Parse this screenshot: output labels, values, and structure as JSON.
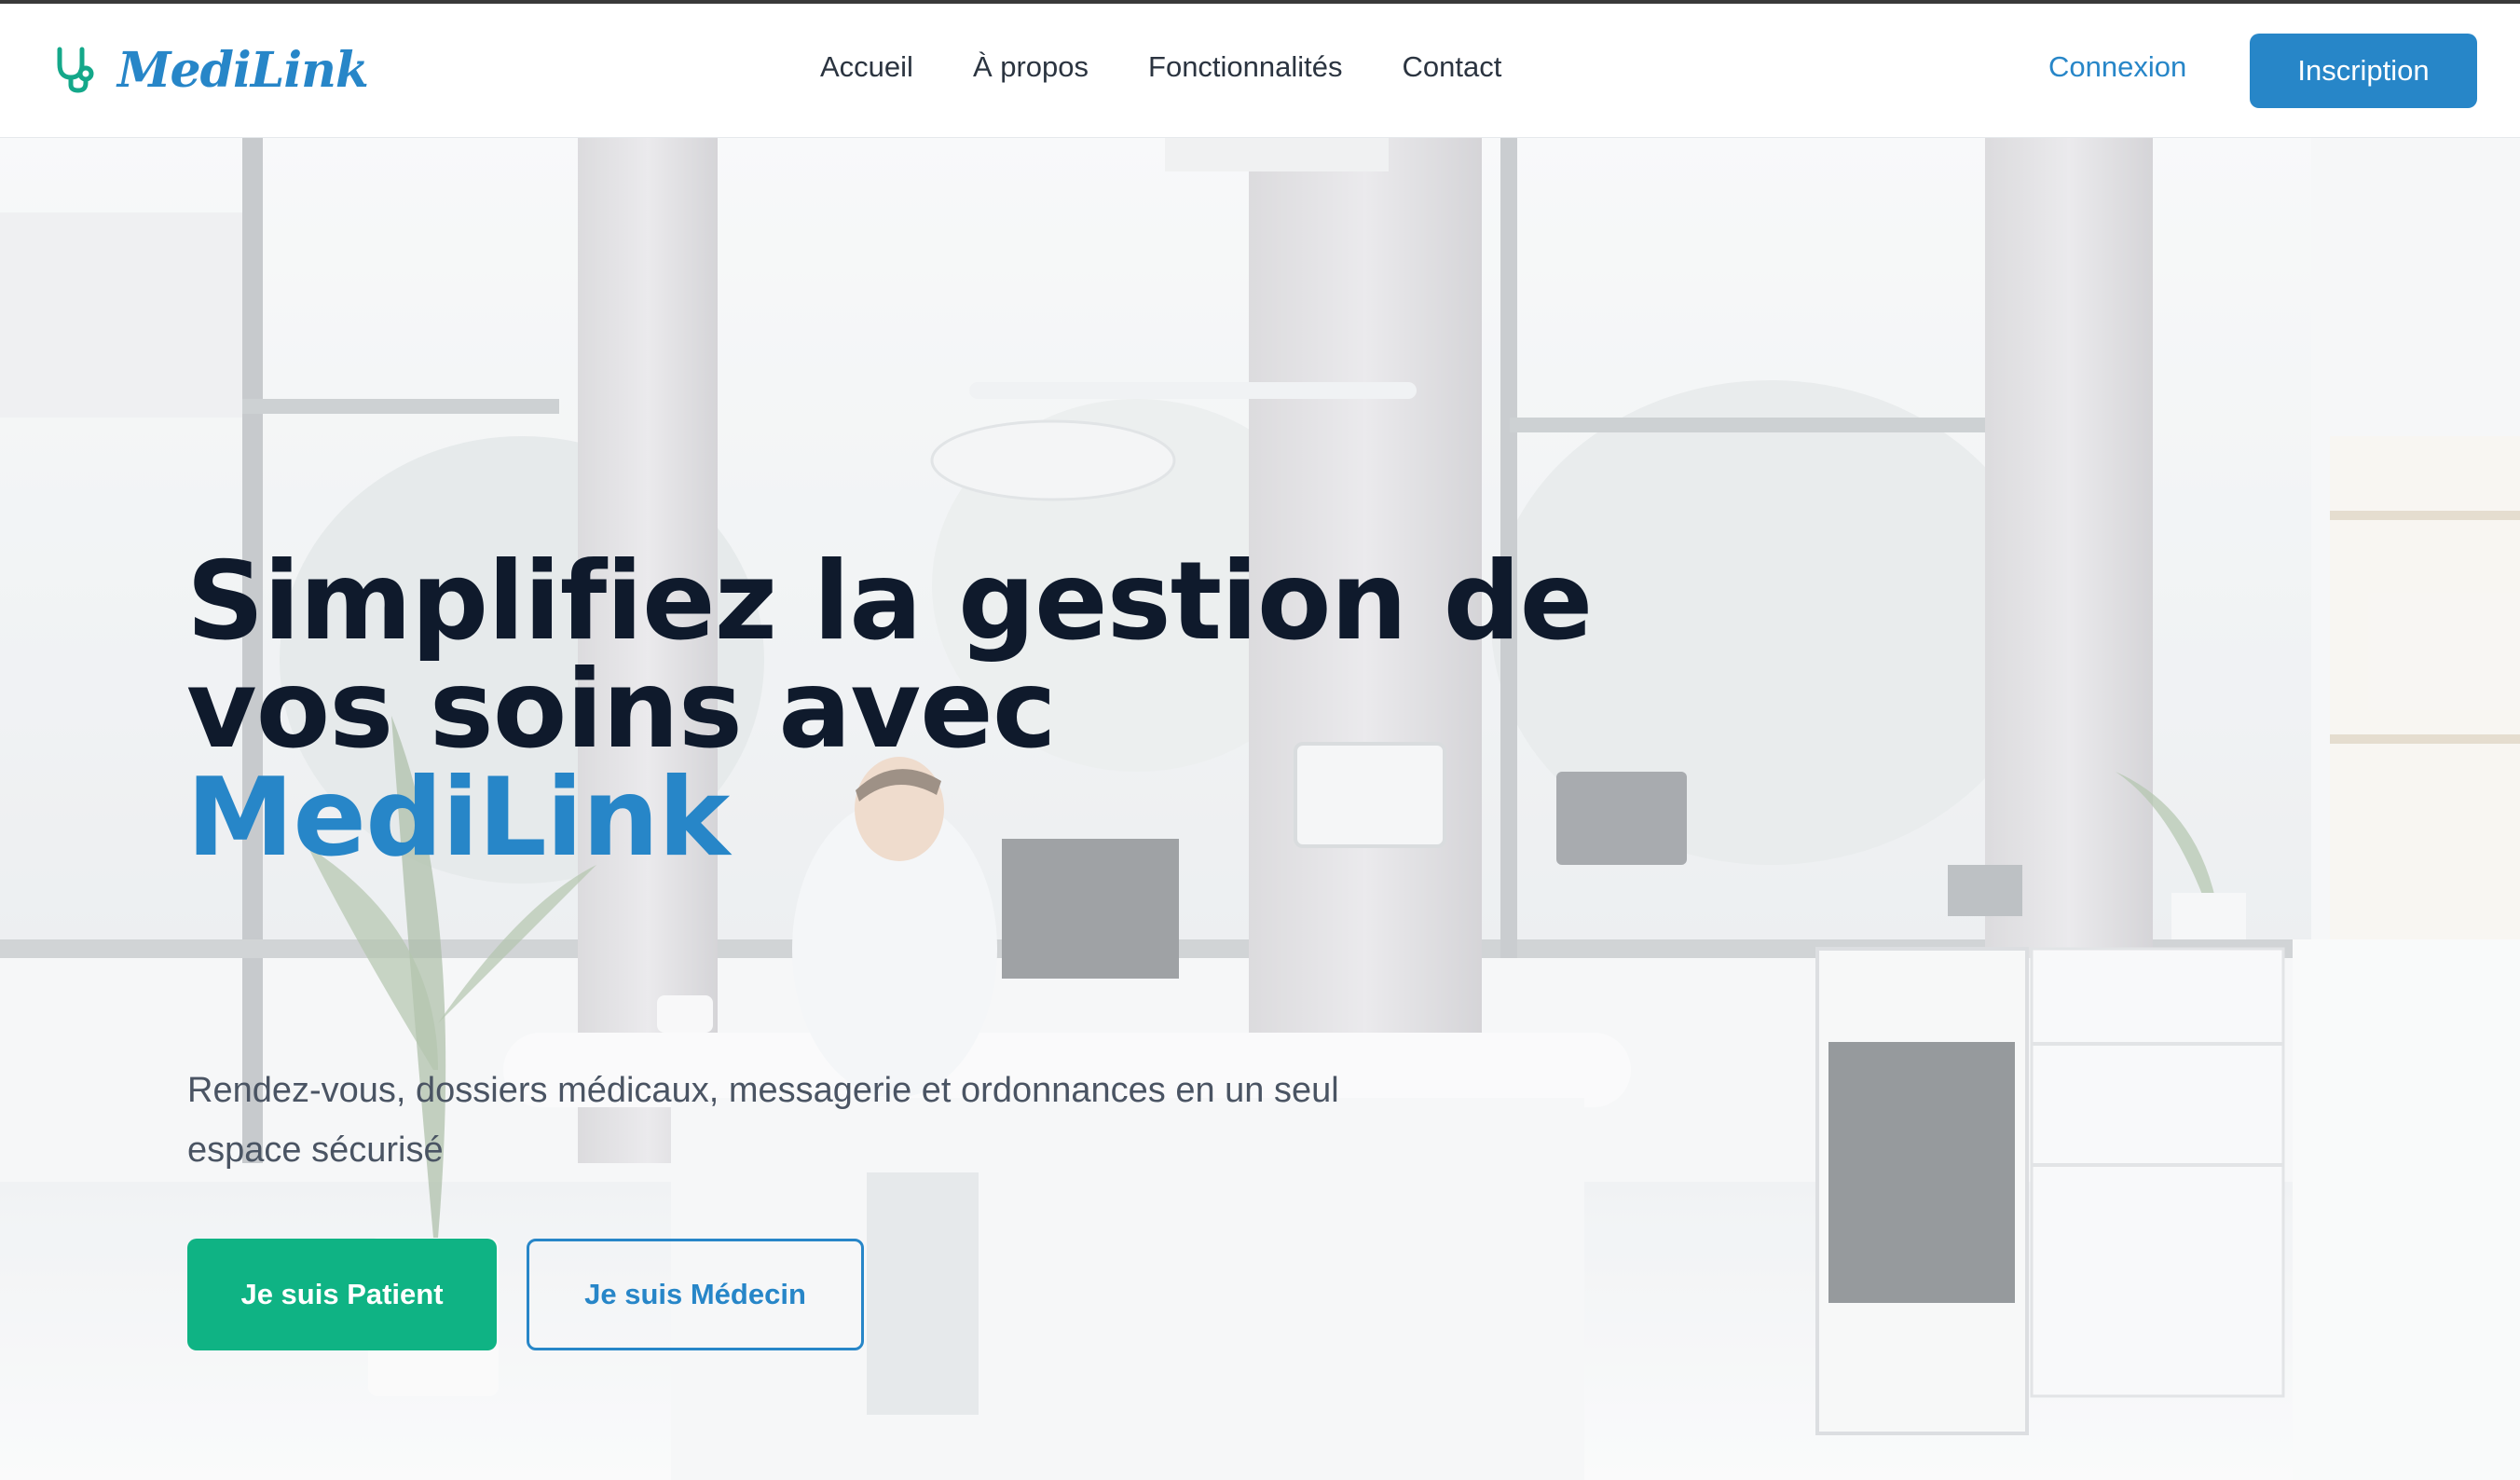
{
  "brand": {
    "name": "MediLink",
    "icon": "stethoscope-icon",
    "color": "#2786c8"
  },
  "nav": {
    "links": [
      "Accueil",
      "À propos",
      "Fonctionnalités",
      "Contact"
    ],
    "login": "Connexion",
    "signup": "Inscription"
  },
  "hero": {
    "headline_line1": "Simplifiez la gestion de",
    "headline_line2": "vos soins avec",
    "headline_brand": "MediLink",
    "subtitle": "Rendez-vous, dossiers médicaux, messagerie et ordonnances en un seul espace sécurisé",
    "patient_button": "Je suis Patient",
    "doctor_button": "Je suis Médecin"
  },
  "colors": {
    "primary": "#2786c8",
    "patient_green": "#0fb384",
    "heading_dark": "#0f1a2c"
  }
}
